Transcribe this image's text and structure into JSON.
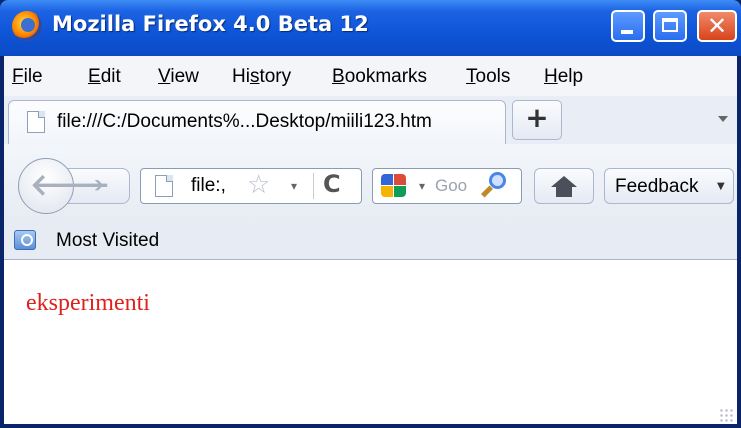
{
  "window": {
    "title": "Mozilla Firefox 4.0 Beta 12",
    "close_glyph": "✕"
  },
  "menu": [
    {
      "pre": "",
      "ul": "F",
      "post": "ile"
    },
    {
      "pre": "",
      "ul": "E",
      "post": "dit"
    },
    {
      "pre": "",
      "ul": "V",
      "post": "iew"
    },
    {
      "pre": "Hi",
      "ul": "s",
      "post": "tory"
    },
    {
      "pre": "",
      "ul": "B",
      "post": "ookmarks"
    },
    {
      "pre": "",
      "ul": "T",
      "post": "ools"
    },
    {
      "pre": "",
      "ul": "H",
      "post": "elp"
    }
  ],
  "tab": {
    "title": "file:///C:/Documents%...Desktop/miili123.htm",
    "new_tab": "+"
  },
  "nav": {
    "back": "🡐",
    "forward": "➔",
    "url": "file:,",
    "star": "☆",
    "dropdown": "▾",
    "reload": "C",
    "search_text": "Goo",
    "feedback": "Feedback",
    "feedback_arrow": "▼"
  },
  "bookmarks": {
    "most_visited": "Most Visited"
  },
  "page": {
    "text": "eksperimenti"
  },
  "colors": {
    "page_text": "#e0211b",
    "titlebar": "#0d55d8"
  },
  "icons": [
    "firefox-logo-icon",
    "minimize-icon",
    "maximize-icon",
    "close-icon",
    "page-icon",
    "back-arrow-icon",
    "forward-arrow-icon",
    "star-icon",
    "reload-icon",
    "google-icon",
    "magnifier-icon",
    "home-icon",
    "most-visited-icon"
  ]
}
